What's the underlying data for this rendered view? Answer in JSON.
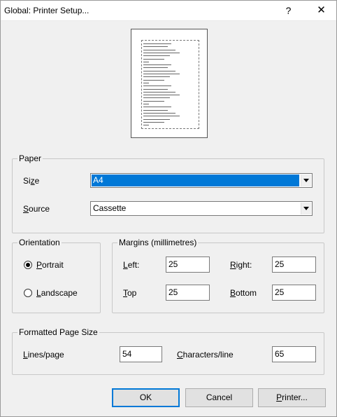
{
  "window": {
    "title": "Global: Printer Setup...",
    "help_label": "?",
    "close_label": "✕"
  },
  "preview": {
    "line_count": 28
  },
  "paper": {
    "group_label": "Paper",
    "size_label": "Size",
    "size_value": "A4",
    "source_label": "Source",
    "source_value": "Cassette"
  },
  "orientation": {
    "group_label": "Orientation",
    "portrait_label": "Portrait",
    "landscape_label": "Landscape",
    "selected": "Portrait"
  },
  "margins": {
    "group_label": "Margins (millimetres)",
    "left_label": "Left:",
    "left_value": "25",
    "right_label": "Right:",
    "right_value": "25",
    "top_label": "Top",
    "top_value": "25",
    "bottom_label": "Bottom",
    "bottom_value": "25"
  },
  "formatted": {
    "group_label": "Formatted Page Size",
    "lines_label": "Lines/page",
    "lines_value": "54",
    "chars_label": "Characters/line",
    "chars_value": "65"
  },
  "buttons": {
    "ok": "OK",
    "cancel": "Cancel",
    "printer": "Printer..."
  }
}
